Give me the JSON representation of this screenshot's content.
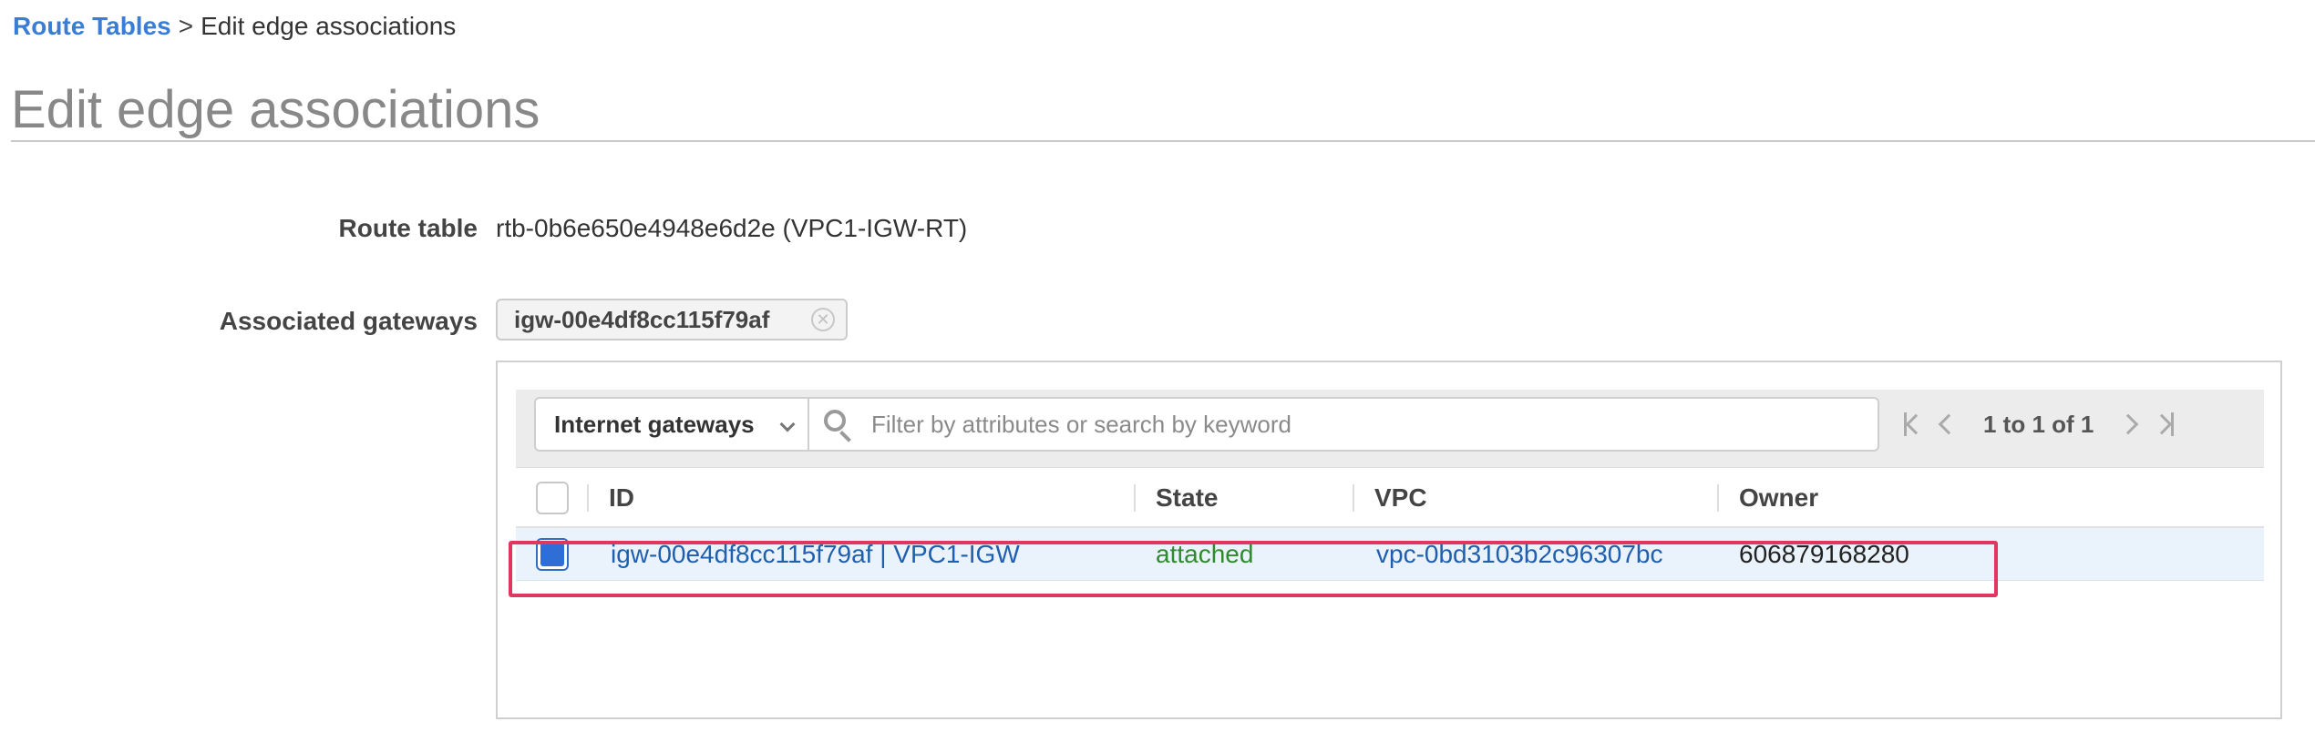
{
  "breadcrumb": {
    "parent": "Route Tables",
    "separator": ">",
    "current": "Edit edge associations"
  },
  "page_title": "Edit edge associations",
  "form": {
    "route_table_label": "Route table",
    "route_table_value": "rtb-0b6e650e4948e6d2e (VPC1-IGW-RT)",
    "associated_gateways_label": "Associated gateways",
    "associated_gateway_token": "igw-00e4df8cc115f79af"
  },
  "toolbar": {
    "filter_type": "Internet gateways",
    "search_placeholder": "Filter by attributes or search by keyword",
    "pagination_text": "1 to 1 of 1"
  },
  "table": {
    "columns": [
      "ID",
      "State",
      "VPC",
      "Owner"
    ],
    "rows": [
      {
        "selected": true,
        "id": "igw-00e4df8cc115f79af | VPC1-IGW",
        "state": "attached",
        "vpc": "vpc-0bd3103b2c96307bc",
        "owner": "606879168280"
      }
    ]
  },
  "colors": {
    "link": "#1f5fae",
    "breadcrumb_link": "#3a7dd6",
    "state_attached": "#2e8b2e",
    "highlight": "#e0365f",
    "selected_row": "#eaf2fb"
  }
}
